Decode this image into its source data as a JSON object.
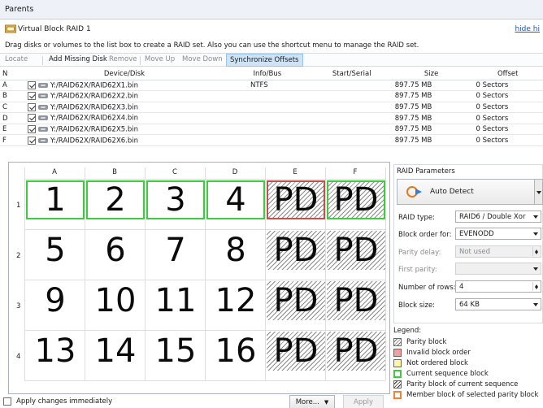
{
  "window": {
    "title": "Parents"
  },
  "header": {
    "title": "Virtual Block RAID 1",
    "hide_link": "hide hi",
    "instructions": "Drag disks or volumes to the list box to create a RAID set. Also you can use the shortcut menu to manage the RAID set."
  },
  "toolbar": {
    "locate": "Locate",
    "add_missing": "Add Missing Disk",
    "remove": "Remove",
    "move_up": "Move Up",
    "move_down": "Move Down",
    "sync": "Synchronize Offsets"
  },
  "disk_table": {
    "columns": [
      "N",
      "Device/Disk",
      "Info/Bus",
      "Start/Serial",
      "Size",
      "Offset"
    ],
    "rows": [
      {
        "n": "A",
        "device": "Y:/RAID62X/RAID62X1.bin",
        "info": "NTFS",
        "start": "",
        "size": "897.75 MB",
        "offset": "0 Sectors"
      },
      {
        "n": "B",
        "device": "Y:/RAID62X/RAID62X2.bin",
        "info": "",
        "start": "",
        "size": "897.75 MB",
        "offset": "0 Sectors"
      },
      {
        "n": "C",
        "device": "Y:/RAID62X/RAID62X3.bin",
        "info": "",
        "start": "",
        "size": "897.75 MB",
        "offset": "0 Sectors"
      },
      {
        "n": "D",
        "device": "Y:/RAID62X/RAID62X4.bin",
        "info": "",
        "start": "",
        "size": "897.75 MB",
        "offset": "0 Sectors"
      },
      {
        "n": "E",
        "device": "Y:/RAID62X/RAID62X5.bin",
        "info": "",
        "start": "",
        "size": "897.75 MB",
        "offset": "0 Sectors"
      },
      {
        "n": "F",
        "device": "Y:/RAID62X/RAID62X6.bin",
        "info": "",
        "start": "",
        "size": "897.75 MB",
        "offset": "0 Sectors"
      }
    ]
  },
  "grid": {
    "columns": [
      "A",
      "B",
      "C",
      "D",
      "E",
      "F"
    ],
    "rows": [
      "1",
      "2",
      "3",
      "4"
    ],
    "cells": [
      [
        "1",
        "2",
        "3",
        "4",
        "PD",
        "PD"
      ],
      [
        "5",
        "6",
        "7",
        "8",
        "PD",
        "PD"
      ],
      [
        "9",
        "10",
        "11",
        "12",
        "PD",
        "PD"
      ],
      [
        "13",
        "14",
        "15",
        "16",
        "PD",
        "PD"
      ]
    ]
  },
  "raid_params": {
    "title": "RAID Parameters",
    "auto_detect": "Auto Detect",
    "raid_type_label": "RAID type:",
    "raid_type_value": "RAID6 / Double Xor",
    "block_order_label": "Block order for:",
    "block_order_value": "EVENODD",
    "parity_delay_label": "Parity delay:",
    "parity_delay_value": "Not used",
    "first_parity_label": "First parity:",
    "first_parity_value": "",
    "rows_label": "Number of rows:",
    "rows_value": "4",
    "block_size_label": "Block size:",
    "block_size_value": "64 KB"
  },
  "legend": {
    "title": "Legend:",
    "items": [
      {
        "label": "Parity block",
        "color": "#ffffff"
      },
      {
        "label": "Invalid block order",
        "color": "#f0a0a0"
      },
      {
        "label": "Not ordered block",
        "color": "#fff5a8"
      },
      {
        "label": "Current sequence block",
        "color": "#3dcc3d"
      },
      {
        "label": "Parity block of current sequence",
        "color": "#ffffff"
      },
      {
        "label": "Member block of selected parity block",
        "color": "#f0803a"
      }
    ]
  },
  "footer": {
    "apply_immediately": "Apply changes immediately",
    "more": "More...",
    "apply": "Apply"
  }
}
